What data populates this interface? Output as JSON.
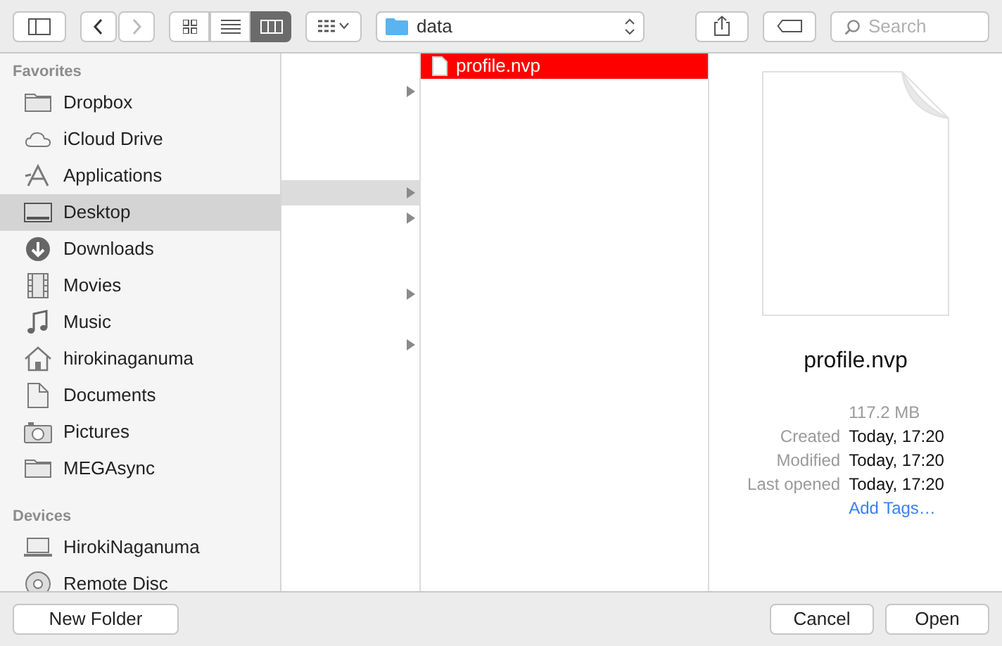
{
  "toolbar": {
    "view_modes": [
      {
        "kind": "icons",
        "selected": false
      },
      {
        "kind": "list",
        "selected": false
      },
      {
        "kind": "columns",
        "selected": true
      }
    ],
    "path_popup": {
      "label": "data"
    },
    "search": {
      "placeholder": "Search"
    }
  },
  "sidebar": {
    "sections": [
      {
        "title": "Favorites",
        "items": [
          {
            "label": "Dropbox",
            "kind": "folder",
            "selected": false
          },
          {
            "label": "iCloud Drive",
            "kind": "cloud",
            "selected": false
          },
          {
            "label": "Applications",
            "kind": "apps",
            "selected": false
          },
          {
            "label": "Desktop",
            "kind": "desktop",
            "selected": true
          },
          {
            "label": "Downloads",
            "kind": "download",
            "selected": false
          },
          {
            "label": "Movies",
            "kind": "film",
            "selected": false
          },
          {
            "label": "Music",
            "kind": "music",
            "selected": false
          },
          {
            "label": "hirokinaganuma",
            "kind": "home",
            "selected": false
          },
          {
            "label": "Documents",
            "kind": "document",
            "selected": false
          },
          {
            "label": "Pictures",
            "kind": "camera",
            "selected": false
          },
          {
            "label": "MEGAsync",
            "kind": "folder",
            "selected": false
          }
        ]
      },
      {
        "title": "Devices",
        "items": [
          {
            "label": "HirokiNaganuma",
            "kind": "laptop",
            "selected": false
          },
          {
            "label": "Remote Disc",
            "kind": "disc",
            "selected": false
          }
        ]
      }
    ]
  },
  "column_1": {
    "rows": [
      {
        "kind": "blank"
      },
      {
        "kind": "folder",
        "selected": false
      },
      {
        "kind": "blank"
      },
      {
        "kind": "blank"
      },
      {
        "kind": "blank"
      },
      {
        "kind": "folder",
        "selected": true
      },
      {
        "kind": "folder",
        "selected": false
      },
      {
        "kind": "blank"
      },
      {
        "kind": "blank"
      },
      {
        "kind": "folder",
        "selected": false
      },
      {
        "kind": "blank"
      },
      {
        "kind": "folder",
        "selected": false
      }
    ]
  },
  "column_2": {
    "rows": [
      {
        "name": "profile.nvp",
        "selected": true
      }
    ]
  },
  "preview": {
    "name": "profile.nvp",
    "size": "117.2 MB",
    "details": [
      {
        "label": "Created",
        "value": "Today, 17:20"
      },
      {
        "label": "Modified",
        "value": "Today, 17:20"
      },
      {
        "label": "Last opened",
        "value": "Today, 17:20"
      }
    ],
    "add_tags": "Add Tags…"
  },
  "buttons": {
    "new_folder": "New Folder",
    "cancel": "Cancel",
    "open": "Open"
  }
}
